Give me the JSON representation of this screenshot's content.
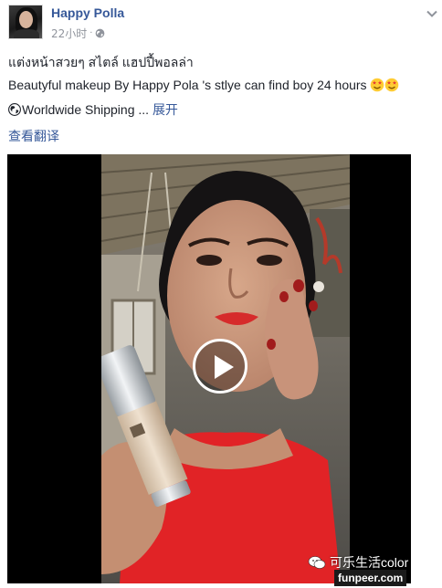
{
  "post": {
    "author": "Happy Polla",
    "time": "22小时",
    "separator": "·",
    "privacy_icon": "globe-icon",
    "menu_icon": "chevron-down-icon"
  },
  "content": {
    "line1": "แต่งหน้าสวยๆ สไตล์ แฮปปี้พอลล่า",
    "line2": "Beautyful makeup By Happy Pola 's stlye can find boy 24 hours",
    "line2_emoji": "star-struck-emoji",
    "line3_icon": "earth-icon",
    "line3": "Worldwide Shipping",
    "ellipsis": " ... ",
    "expand": "展开",
    "translate": "查看翻译"
  },
  "video": {
    "play_icon": "play-icon"
  },
  "watermark": {
    "icon": "wechat-icon",
    "brand": "可乐生活color",
    "site": "funpeer.com"
  },
  "colors": {
    "link": "#365899",
    "meta": "#90949c",
    "text": "#1d2129"
  }
}
